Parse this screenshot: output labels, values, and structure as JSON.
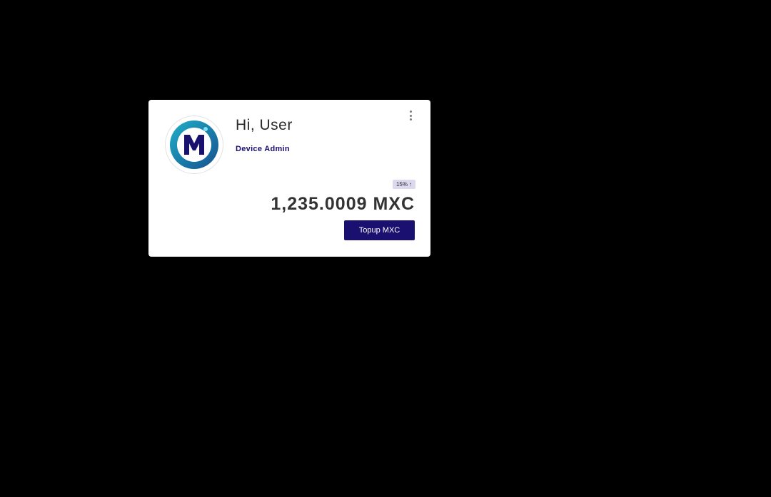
{
  "profile": {
    "avatar_icon": "mxc-logo-icon",
    "greeting": "Hi, User",
    "role": "Device Admin"
  },
  "card_menu": {
    "icon": "more-vertical-icon"
  },
  "balance": {
    "change_percent": "15%",
    "change_arrow": "↑",
    "amount": "1,235.0009 MXC"
  },
  "actions": {
    "topup_label": "Topup MXC"
  },
  "colors": {
    "background": "#000000",
    "card": "#ffffff",
    "accent": "#1a1070",
    "badge_bg": "#dcd9ee",
    "logo_gradient_start": "#1fb0c8",
    "logo_gradient_end": "#15508f"
  }
}
